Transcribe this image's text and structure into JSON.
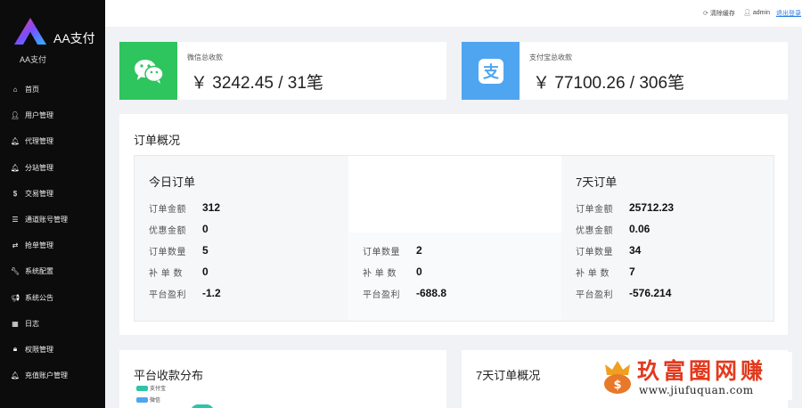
{
  "app": {
    "title": "AA支付",
    "subtitle": "AA支付"
  },
  "sidebar": {
    "items": [
      {
        "label": "首页",
        "icon": "home-icon"
      },
      {
        "label": "用户管理",
        "icon": "user-icon"
      },
      {
        "label": "代理管理",
        "icon": "bell-icon"
      },
      {
        "label": "分站管理",
        "icon": "bell-icon"
      },
      {
        "label": "交易管理",
        "icon": "dollar-icon"
      },
      {
        "label": "通道账号管理",
        "icon": "list-icon"
      },
      {
        "label": "抢单管理",
        "icon": "exchange-icon"
      },
      {
        "label": "系统配置",
        "icon": "wrench-icon"
      },
      {
        "label": "系统公告",
        "icon": "bullhorn-icon"
      },
      {
        "label": "日志",
        "icon": "calendar-icon"
      },
      {
        "label": "权限管理",
        "icon": "lock-icon"
      },
      {
        "label": "充值账户管理",
        "icon": "bell-icon"
      }
    ]
  },
  "topbar": {
    "clear_cache": "清除缓存",
    "user": "admin",
    "logout": "退出登录"
  },
  "stats": {
    "wechat": {
      "label": "微信总收款",
      "value": "￥ 3242.45 / 31笔"
    },
    "alipay": {
      "label": "支付宝总收款",
      "value": "￥ 77100.26 / 306笔"
    }
  },
  "overview": {
    "title": "订单概况",
    "today": {
      "title": "今日订单",
      "rows": [
        {
          "label": "订单金额",
          "value": "312"
        },
        {
          "label": "优惠金额",
          "value": "0"
        },
        {
          "label": "订单数量",
          "value": "5"
        },
        {
          "label": "补 单 数",
          "value": "0"
        },
        {
          "label": "平台盈利",
          "value": "-1.2"
        }
      ]
    },
    "middle": {
      "rows": [
        {
          "label": "订单数量",
          "value": "2"
        },
        {
          "label": "补 单 数",
          "value": "0"
        },
        {
          "label": "平台盈利",
          "value": "-688.8"
        }
      ]
    },
    "week": {
      "title": "7天订单",
      "rows": [
        {
          "label": "订单金额",
          "value": "25712.23"
        },
        {
          "label": "优惠金额",
          "value": "0.06"
        },
        {
          "label": "订单数量",
          "value": "34"
        },
        {
          "label": "补 单 数",
          "value": "7"
        },
        {
          "label": "平台盈利",
          "value": "-576.214"
        }
      ]
    }
  },
  "bottom": {
    "distribution": {
      "title": "平台收款分布",
      "legend": [
        "支付宝",
        "微信"
      ]
    },
    "week_overview": {
      "title": "7天订单概况"
    }
  },
  "colors": {
    "sidebar": "#0c0c0c",
    "wechat": "#2ec45e",
    "alipay": "#4fa5f0",
    "legend_alipay": "#2ec4a8",
    "legend_wechat": "#4fa5f0",
    "watermark": "#e23a1e"
  },
  "watermark": {
    "text": "玖富圈网赚",
    "url": "www.jiufuquan.com"
  }
}
